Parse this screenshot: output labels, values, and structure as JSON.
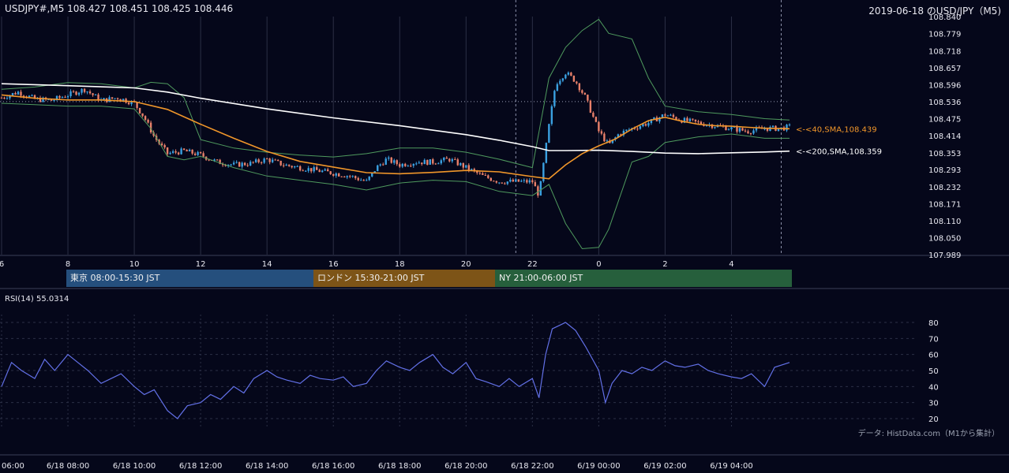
{
  "header": {
    "price_info": "USDJPY#,M5 108.427 108.451 108.425 108.446",
    "title": "2019-06-18 のUSD/JPY（M5)"
  },
  "colors": {
    "background": "#05071a",
    "grid": "#2b2f45",
    "bull_candle": "#3aa0e0",
    "bear_candle": "#e8806a",
    "sma40": "#f0962a",
    "sma200": "#ffffff",
    "bollinger": "#4f9a5e",
    "rsi_line": "#6270e6",
    "tokyo": "#254f7d",
    "london": "#7d5417",
    "ny": "#265f3c"
  },
  "sessions": [
    {
      "label": "東京 08:00-15:30 JST"
    },
    {
      "label": "ロンドン 15:30-21:00 JST"
    },
    {
      "label": "NY 21:00-06:00 JST"
    }
  ],
  "rsi": {
    "label": "RSI(14) 55.0314"
  },
  "source": "データ: HistData.com（M1から集計）",
  "chart_data": [
    {
      "type": "line",
      "title": "2019-06-18 のUSD/JPY（M5)",
      "x_ticks": [
        "6",
        "8",
        "10",
        "12",
        "14",
        "16",
        "18",
        "20",
        "22",
        "0",
        "2",
        "4"
      ],
      "y_ticks": [
        "108.840",
        "108.779",
        "108.718",
        "108.657",
        "108.596",
        "108.536",
        "108.475",
        "108.414",
        "108.353",
        "108.293",
        "108.232",
        "108.171",
        "108.110",
        "108.050",
        "107.989"
      ],
      "ylim": [
        107.989,
        108.84
      ],
      "x_range_hours": [
        6,
        29.75
      ],
      "series": [
        {
          "name": "SMA40",
          "label": "<-<40,SMA,108.439",
          "x": [
            6,
            7,
            8,
            9,
            10,
            11,
            12,
            13,
            14,
            15,
            16,
            17,
            18,
            19,
            20,
            21,
            22,
            22.5,
            23,
            23.5,
            24,
            24.5,
            25,
            25.5,
            26,
            26.5,
            27,
            27.5,
            28,
            28.5,
            29,
            29.75
          ],
          "y": [
            108.56,
            108.548,
            108.542,
            108.542,
            108.536,
            108.508,
            108.455,
            108.405,
            108.358,
            108.322,
            108.302,
            108.282,
            108.278,
            108.283,
            108.29,
            108.285,
            108.268,
            108.26,
            108.31,
            108.35,
            108.378,
            108.402,
            108.438,
            108.468,
            108.48,
            108.466,
            108.455,
            108.45,
            108.448,
            108.444,
            108.441,
            108.439
          ]
        },
        {
          "name": "SMA200",
          "label": "<-<200,SMA,108.359",
          "x": [
            6,
            8,
            10,
            11,
            12,
            14,
            16,
            18,
            20,
            21,
            22,
            22.5,
            23,
            24,
            25,
            26,
            27,
            28,
            29,
            29.75
          ],
          "y": [
            108.6,
            108.593,
            108.585,
            108.57,
            108.548,
            108.51,
            108.478,
            108.45,
            108.418,
            108.398,
            108.375,
            108.361,
            108.361,
            108.362,
            108.358,
            108.352,
            108.35,
            108.353,
            108.356,
            108.359
          ]
        },
        {
          "name": "Bollinger upper",
          "x": [
            6,
            7,
            8,
            9,
            10,
            10.5,
            11,
            11.5,
            12,
            13,
            14,
            15,
            16,
            17,
            18,
            19,
            20,
            21,
            22,
            22.5,
            23,
            23.5,
            24,
            24.3,
            25,
            25.5,
            26,
            27,
            28,
            29,
            29.75
          ],
          "y": [
            108.58,
            108.588,
            108.604,
            108.6,
            108.585,
            108.605,
            108.6,
            108.55,
            108.4,
            108.37,
            108.355,
            108.345,
            108.338,
            108.35,
            108.37,
            108.37,
            108.355,
            108.33,
            108.3,
            108.62,
            108.73,
            108.79,
            108.83,
            108.78,
            108.76,
            108.62,
            108.52,
            108.5,
            108.49,
            108.475,
            108.47
          ]
        },
        {
          "name": "Bollinger lower",
          "x": [
            6,
            7,
            8,
            9,
            10,
            10.5,
            11,
            11.5,
            12,
            13,
            14,
            15,
            16,
            17,
            18,
            19,
            20,
            21,
            22,
            22.5,
            23,
            23.5,
            24,
            24.3,
            25,
            25.5,
            26,
            27,
            28,
            29,
            29.75
          ],
          "y": [
            108.53,
            108.525,
            108.52,
            108.52,
            108.51,
            108.44,
            108.34,
            108.328,
            108.34,
            108.3,
            108.27,
            108.255,
            108.24,
            108.22,
            108.245,
            108.255,
            108.25,
            108.215,
            108.2,
            108.24,
            108.1,
            108.01,
            108.015,
            108.08,
            108.32,
            108.34,
            108.39,
            108.41,
            108.42,
            108.405,
            108.405
          ]
        },
        {
          "name": "Close",
          "x": [
            6,
            6.5,
            7,
            7.5,
            8,
            8.5,
            9,
            9.5,
            10,
            10.3,
            10.6,
            11,
            11.5,
            12,
            12.5,
            13,
            13.5,
            14,
            14.5,
            15,
            15.5,
            16,
            16.5,
            17,
            17.3,
            17.6,
            18,
            18.5,
            19,
            19.5,
            20,
            20.5,
            21,
            21.5,
            22,
            22.2,
            22.5,
            22.7,
            23,
            23.3,
            23.6,
            24,
            24.3,
            24.6,
            25,
            25.5,
            26,
            26.5,
            27,
            27.5,
            28,
            28.5,
            29,
            29.5,
            29.75
          ],
          "y": [
            108.55,
            108.57,
            108.545,
            108.54,
            108.56,
            108.58,
            108.54,
            108.55,
            108.53,
            108.48,
            108.41,
            108.35,
            108.36,
            108.345,
            108.32,
            108.31,
            108.315,
            108.33,
            108.31,
            108.3,
            108.29,
            108.28,
            108.27,
            108.25,
            108.3,
            108.33,
            108.31,
            108.32,
            108.32,
            108.33,
            108.3,
            108.27,
            108.25,
            108.25,
            108.25,
            108.2,
            108.45,
            108.6,
            108.64,
            108.61,
            108.55,
            108.43,
            108.38,
            108.42,
            108.44,
            108.46,
            108.49,
            108.47,
            108.46,
            108.45,
            108.44,
            108.43,
            108.44,
            108.44,
            108.446
          ]
        }
      ],
      "annotations": [
        "<-<40,SMA,108.439",
        "<-<200,SMA,108.359"
      ]
    },
    {
      "type": "line",
      "title": "RSI(14) 55.0314",
      "y_ticks": [
        "80",
        "70",
        "60",
        "50",
        "40",
        "30",
        "20"
      ],
      "ylim": [
        20,
        80
      ],
      "x_tick_labels": [
        "06:00",
        "6/18 08:00",
        "6/18 10:00",
        "6/18 12:00",
        "6/18 14:00",
        "6/18 16:00",
        "6/18 18:00",
        "6/18 20:00",
        "6/18 22:00",
        "6/19 00:00",
        "6/19 02:00",
        "6/19 04:00"
      ],
      "series": [
        {
          "name": "RSI(14)",
          "x": [
            6,
            6.3,
            6.6,
            7,
            7.3,
            7.6,
            8,
            8.3,
            8.6,
            9,
            9.3,
            9.6,
            10,
            10.3,
            10.6,
            11,
            11.3,
            11.6,
            12,
            12.3,
            12.6,
            13,
            13.3,
            13.6,
            14,
            14.3,
            14.6,
            15,
            15.3,
            15.6,
            16,
            16.3,
            16.6,
            17,
            17.3,
            17.6,
            18,
            18.3,
            18.6,
            19,
            19.3,
            19.6,
            20,
            20.3,
            20.6,
            21,
            21.3,
            21.6,
            22,
            22.2,
            22.4,
            22.6,
            22.8,
            23,
            23.3,
            23.6,
            24,
            24.2,
            24.4,
            24.7,
            25,
            25.3,
            25.6,
            26,
            26.3,
            26.6,
            27,
            27.3,
            27.6,
            28,
            28.3,
            28.6,
            29,
            29.3,
            29.75
          ],
          "y": [
            40,
            55,
            50,
            45,
            57,
            50,
            60,
            55,
            50,
            42,
            45,
            48,
            40,
            35,
            38,
            25,
            20,
            28,
            30,
            35,
            32,
            40,
            36,
            45,
            50,
            46,
            44,
            42,
            47,
            45,
            44,
            46,
            40,
            42,
            50,
            56,
            52,
            50,
            55,
            60,
            52,
            48,
            55,
            45,
            43,
            40,
            45,
            40,
            45,
            33,
            60,
            76,
            78,
            80,
            75,
            65,
            50,
            30,
            42,
            50,
            48,
            52,
            50,
            56,
            53,
            52,
            54,
            50,
            48,
            46,
            45,
            48,
            40,
            52,
            55
          ]
        }
      ]
    }
  ]
}
